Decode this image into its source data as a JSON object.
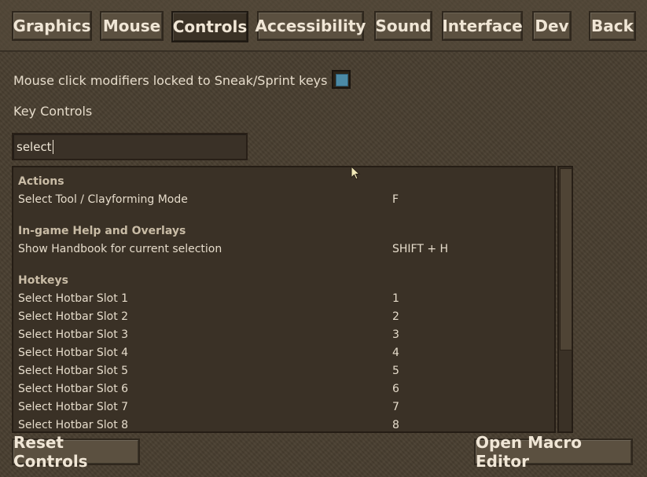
{
  "tabs": [
    {
      "label": "Graphics"
    },
    {
      "label": "Mouse"
    },
    {
      "label": "Controls"
    },
    {
      "label": "Accessibility"
    },
    {
      "label": "Sound"
    },
    {
      "label": "Interface"
    },
    {
      "label": "Dev"
    }
  ],
  "back_label": "Back",
  "settings": {
    "mouse_modifier_label": "Mouse click modifiers locked to Sneak/Sprint keys",
    "key_controls_label": "Key Controls"
  },
  "search": {
    "value": "select"
  },
  "groups": [
    {
      "title": "Actions",
      "items": [
        {
          "name": "Select Tool / Clayforming Mode",
          "key": "F"
        }
      ]
    },
    {
      "title": "In-game Help and Overlays",
      "items": [
        {
          "name": "Show Handbook for current selection",
          "key": "SHIFT + H"
        }
      ]
    },
    {
      "title": "Hotkeys",
      "items": [
        {
          "name": "Select Hotbar Slot 1",
          "key": "1"
        },
        {
          "name": "Select Hotbar Slot 2",
          "key": "2"
        },
        {
          "name": "Select Hotbar Slot 3",
          "key": "3"
        },
        {
          "name": "Select Hotbar Slot 4",
          "key": "4"
        },
        {
          "name": "Select Hotbar Slot 5",
          "key": "5"
        },
        {
          "name": "Select Hotbar Slot 6",
          "key": "6"
        },
        {
          "name": "Select Hotbar Slot 7",
          "key": "7"
        },
        {
          "name": "Select Hotbar Slot 8",
          "key": "8"
        }
      ]
    }
  ],
  "footer": {
    "reset_label": "Reset Controls",
    "macro_label": "Open Macro Editor"
  },
  "colors": {
    "toggle_accent": "#4b8aa6"
  }
}
